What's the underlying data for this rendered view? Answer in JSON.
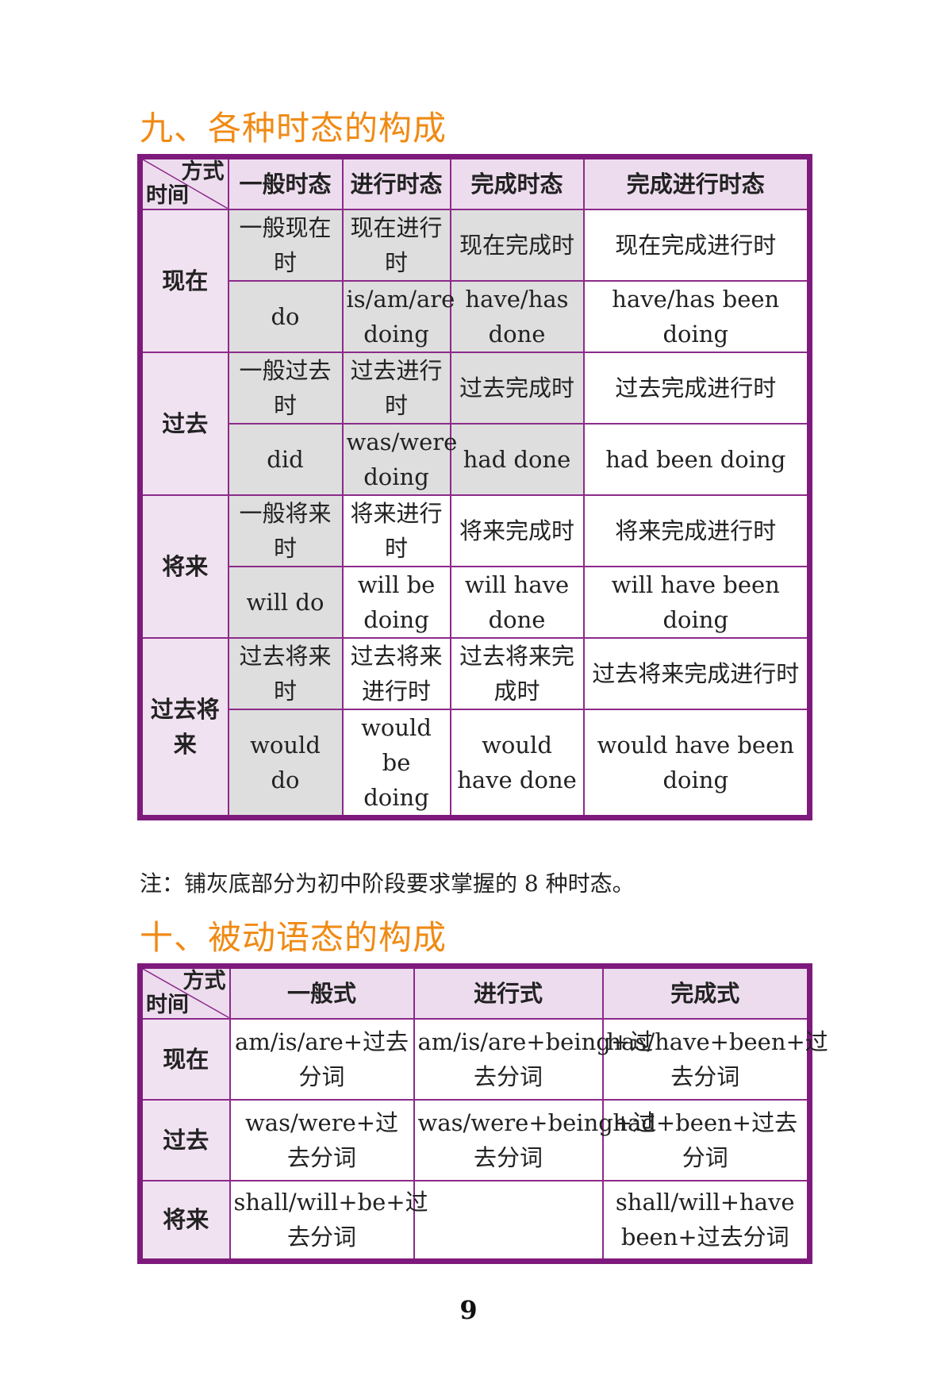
{
  "titles": {
    "tense": "九、各种时态的构成",
    "passive": "十、被动语态的构成"
  },
  "tense_table": {
    "corner_top": "方式",
    "corner_bottom": "时间",
    "headers": [
      "一般时态",
      "进行时态",
      "完成时态",
      "完成进行时态"
    ],
    "rows": [
      {
        "label": "现在",
        "names": [
          "一般现在时",
          "现在进行时",
          "现在完成时",
          "现在完成进行时"
        ],
        "forms": [
          "do",
          "is/am/are doing",
          "have/has done",
          "have/has been doing"
        ]
      },
      {
        "label": "过去",
        "names": [
          "一般过去时",
          "过去进行时",
          "过去完成时",
          "过去完成进行时"
        ],
        "forms": [
          "did",
          "was/were doing",
          "had done",
          "had been doing"
        ]
      },
      {
        "label": "将来",
        "names": [
          "一般将来时",
          "将来进行时",
          "将来完成时",
          "将来完成进行时"
        ],
        "forms": [
          "will do",
          "will be doing",
          "will have done",
          "will have been doing"
        ]
      },
      {
        "label": "过去将来",
        "names": [
          "过去将来时",
          "过去将来进行时",
          "过去将来完成时",
          "过去将来完成进行时"
        ],
        "forms": [
          "would do",
          "would be doing",
          "would have done",
          "would have been doing"
        ]
      }
    ]
  },
  "note": "注：铺灰底部分为初中阶段要求掌握的 8 种时态。",
  "passive_table": {
    "corner_top": "方式",
    "corner_bottom": "时间",
    "headers": [
      "一般式",
      "进行式",
      "完成式"
    ],
    "rows": [
      {
        "label": "现在",
        "cells": [
          "am/is/are+过去分词",
          "am/is/are+being+过去分词",
          "has/have+been+过去分词"
        ]
      },
      {
        "label": "过去",
        "cells": [
          "was/were+过去分词",
          "was/were+being+过去分词",
          "had+been+过去分词"
        ]
      },
      {
        "label": "将来",
        "cells": [
          "shall/will+be+过去分词",
          "",
          "shall/will+have been+过去分词"
        ]
      }
    ]
  },
  "page_number": "9",
  "colors": {
    "title": "#f08a14",
    "border": "#7e1a7c",
    "header_bg": "#eddcee",
    "highlight_gray": "#dedede"
  }
}
